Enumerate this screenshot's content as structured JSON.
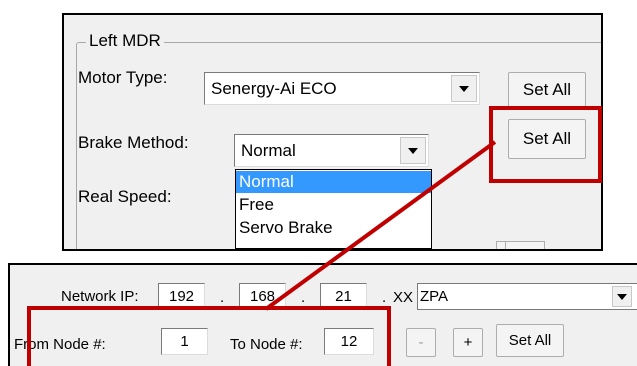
{
  "left_mdr": {
    "group_title": "Left MDR",
    "motor_type_label": "Motor Type:",
    "motor_type_value": "Senergy-Ai ECO",
    "motor_set_all": "Set All",
    "brake_method_label": "Brake Method:",
    "brake_method_value": "Normal",
    "brake_set_all": "Set All",
    "real_speed_label": "Real Speed:",
    "brake_options": [
      "Normal",
      "Free",
      "Servo Brake"
    ]
  },
  "network": {
    "ip_label": "Network IP:",
    "octet1": "192",
    "octet2": "168",
    "octet3": "21",
    "dot": ".",
    "xx": "XX",
    "mode_value": "ZPA",
    "from_node_label": "From Node #:",
    "from_node_value": "1",
    "to_node_label": "To Node #:",
    "to_node_value": "12",
    "minus_label": "-",
    "plus_label": "+",
    "set_all_label": "Set All"
  },
  "colors": {
    "highlight": "#c00000",
    "selection": "#3399ff",
    "panel_bg": "#f0f0f0"
  }
}
